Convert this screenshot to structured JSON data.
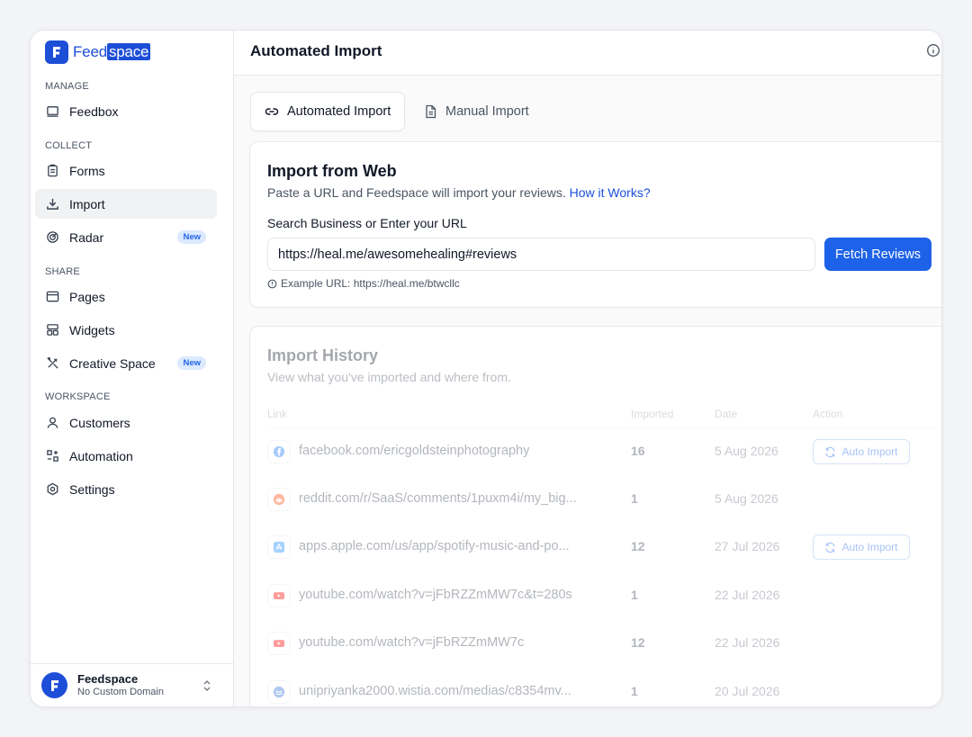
{
  "brand": {
    "name_part1": "Feed",
    "name_part2": "space"
  },
  "sidebar": {
    "sections": {
      "manage": "MANAGE",
      "collect": "COLLECT",
      "share": "SHARE",
      "workspace": "WORKSPACE"
    },
    "items": [
      {
        "label": "Feedbox",
        "icon": "inbox-icon"
      },
      {
        "label": "Forms",
        "icon": "clipboard-icon"
      },
      {
        "label": "Import",
        "icon": "download-icon",
        "active": true
      },
      {
        "label": "Radar",
        "icon": "radar-icon",
        "badge": "New"
      },
      {
        "label": "Pages",
        "icon": "browser-icon"
      },
      {
        "label": "Widgets",
        "icon": "widgets-icon"
      },
      {
        "label": "Creative Space",
        "icon": "pencil-ruler-icon",
        "badge": "New"
      },
      {
        "label": "Customers",
        "icon": "user-icon"
      },
      {
        "label": "Automation",
        "icon": "automation-icon"
      },
      {
        "label": "Settings",
        "icon": "gear-icon"
      }
    ],
    "footer": {
      "name": "Feedspace",
      "domain": "No Custom Domain"
    }
  },
  "header": {
    "title": "Automated Import"
  },
  "tabs": [
    {
      "label": "Automated Import",
      "icon": "link-icon",
      "active": true
    },
    {
      "label": "Manual Import",
      "icon": "document-icon",
      "active": false
    }
  ],
  "import_card": {
    "title": "Import from Web",
    "subtitle": "Paste a URL and Feedspace will import your reviews.",
    "help_link": "How it Works?",
    "field_label": "Search Business or Enter your URL",
    "url_value": "https://heal.me/awesomehealing#reviews",
    "button_label": "Fetch Reviews",
    "hint": "Example URL: https://heal.me/btwcllc"
  },
  "history": {
    "title": "Import History",
    "subtitle": "View what you've imported and where from.",
    "columns": [
      "Link",
      "Imported",
      "Date",
      "Action"
    ],
    "action_label": "Auto Import",
    "rows": [
      {
        "source": "facebook",
        "link": "facebook.com/ericgoldsteinphotography",
        "imported": "16",
        "date": "5 Aug 2026",
        "action": true
      },
      {
        "source": "reddit",
        "link": "reddit.com/r/SaaS/comments/1puxm4i/my_big...",
        "imported": "1",
        "date": "5 Aug 2026",
        "action": false
      },
      {
        "source": "appstore",
        "link": "apps.apple.com/us/app/spotify-music-and-po...",
        "imported": "12",
        "date": "27 Jul 2026",
        "action": true
      },
      {
        "source": "youtube",
        "link": "youtube.com/watch?v=jFbRZZmMW7c&t=280s",
        "imported": "1",
        "date": "22 Jul 2026",
        "action": false
      },
      {
        "source": "youtube",
        "link": "youtube.com/watch?v=jFbRZZmMW7c",
        "imported": "12",
        "date": "22 Jul 2026",
        "action": false
      },
      {
        "source": "wistia",
        "link": "unipriyanka2000.wistia.com/medias/c8354mv...",
        "imported": "1",
        "date": "20 Jul 2026",
        "action": false
      }
    ]
  },
  "colors": {
    "accent": "#1d62e8",
    "brand": "#1d4ed8",
    "badge_bg": "#dbeafe"
  }
}
